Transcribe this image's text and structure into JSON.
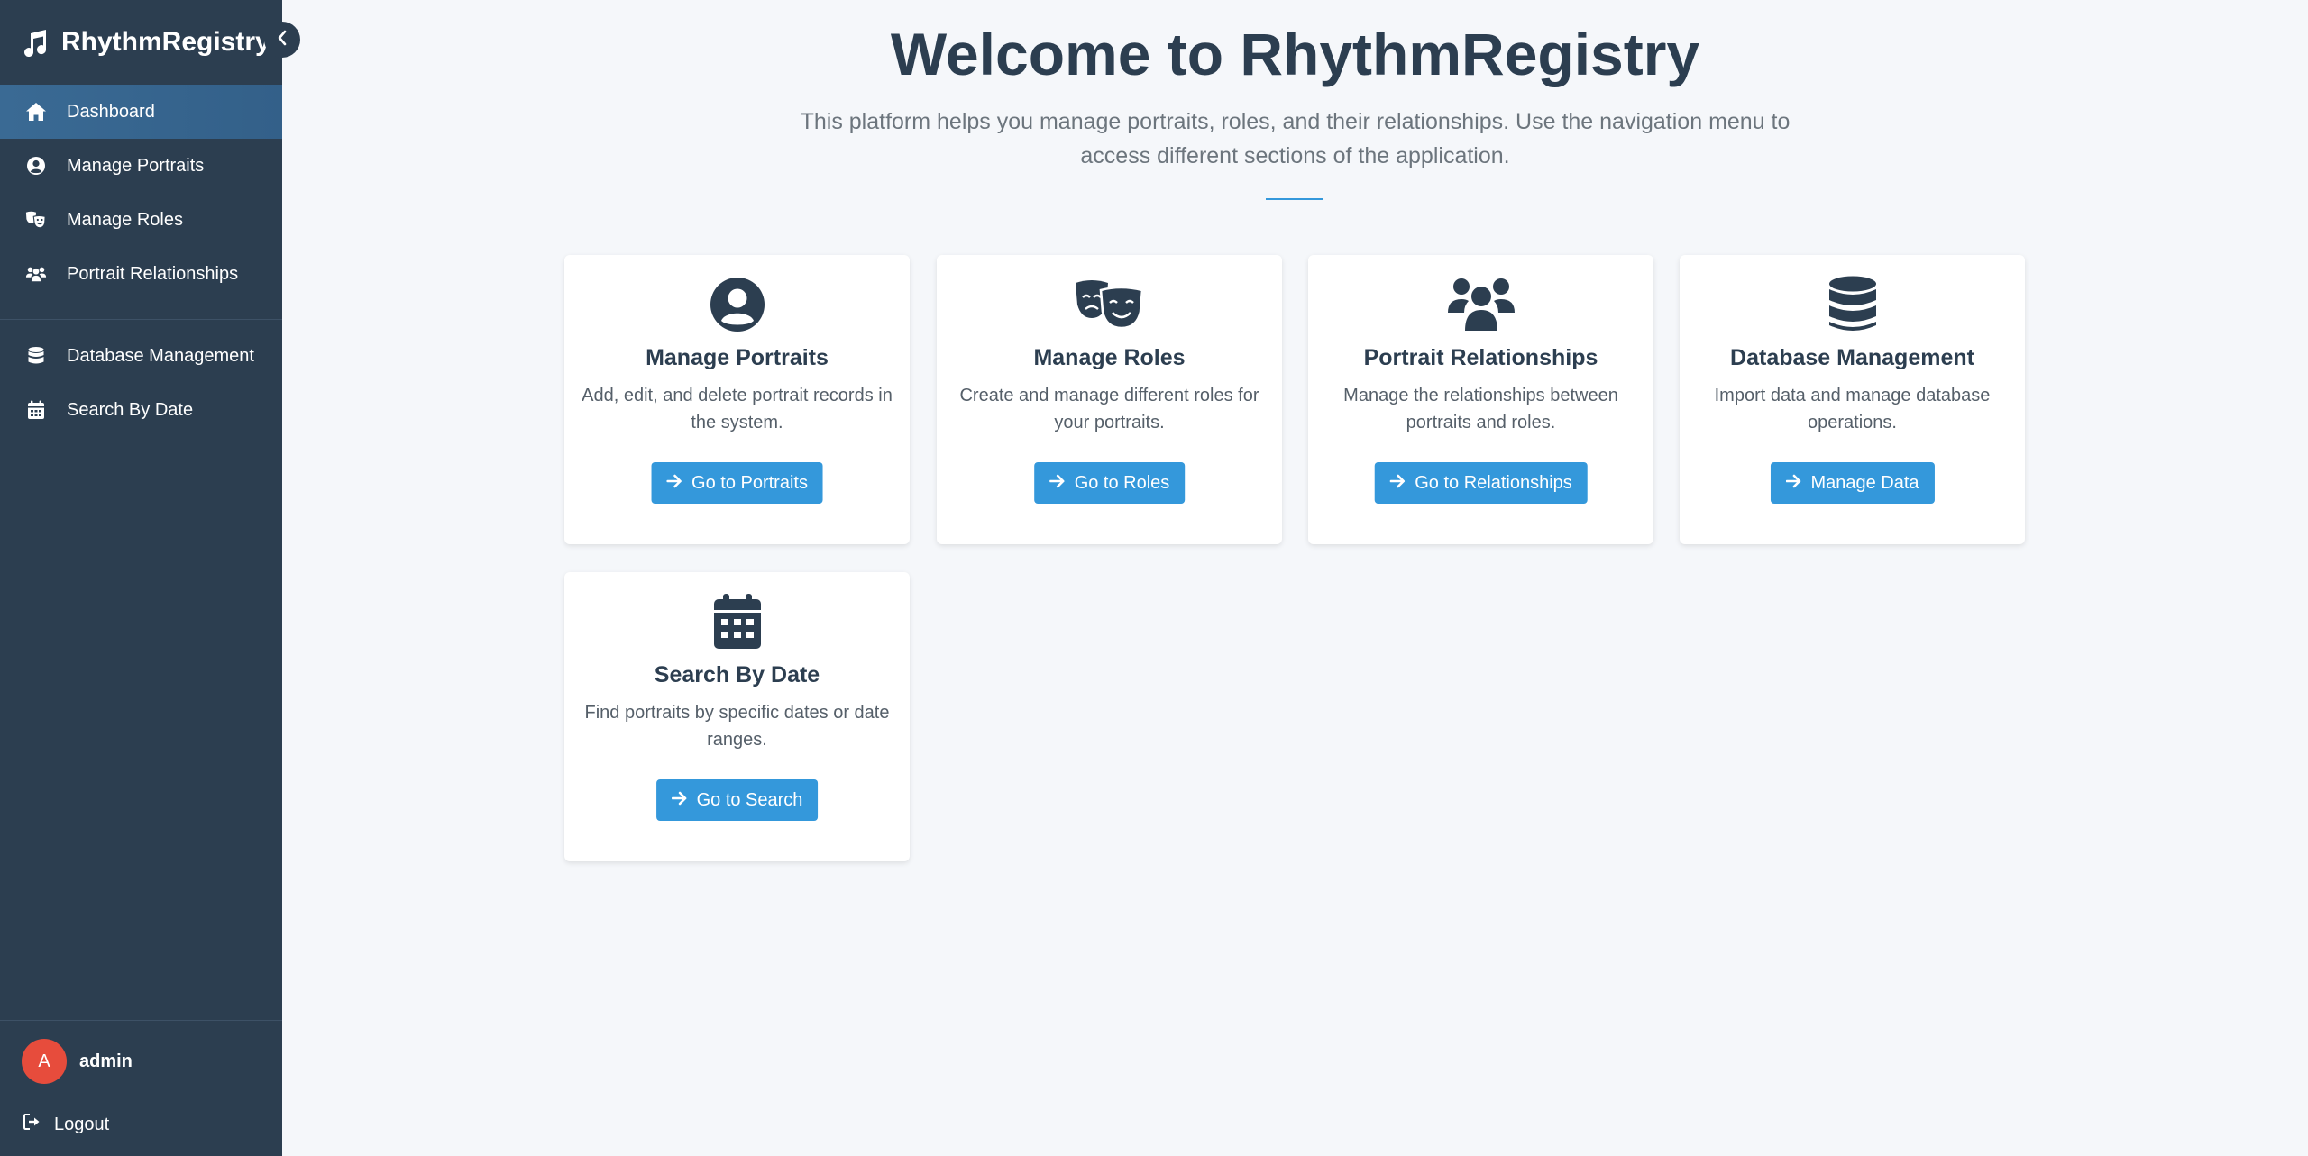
{
  "app": {
    "name": "RhythmRegistry",
    "logo_icon": "music-note-icon"
  },
  "sidebar": {
    "items": [
      {
        "label": "Dashboard",
        "icon": "home-icon",
        "active": true
      },
      {
        "label": "Manage Portraits",
        "icon": "user-circle-icon"
      },
      {
        "label": "Manage Roles",
        "icon": "theater-masks-icon"
      },
      {
        "label": "Portrait Relationships",
        "icon": "users-icon"
      }
    ],
    "items2": [
      {
        "label": "Database Management",
        "icon": "database-icon"
      },
      {
        "label": "Search By Date",
        "icon": "calendar-icon"
      }
    ],
    "user": {
      "initial": "A",
      "name": "admin",
      "avatar_color": "#e74c3c"
    },
    "logout_label": "Logout"
  },
  "main": {
    "title": "Welcome to RhythmRegistry",
    "subtitle": "This platform helps you manage portraits, roles, and their relationships. Use the navigation menu to access different sections of the application.",
    "cards": [
      {
        "title": "Manage Portraits",
        "description": "Add, edit, and delete portrait records in the system.",
        "button": "Go to Portraits",
        "icon": "user-circle-icon"
      },
      {
        "title": "Manage Roles",
        "description": "Create and manage different roles for your portraits.",
        "button": "Go to Roles",
        "icon": "theater-masks-icon"
      },
      {
        "title": "Portrait Relationships",
        "description": "Manage the relationships between portraits and roles.",
        "button": "Go to Relationships",
        "icon": "users-icon"
      },
      {
        "title": "Database Management",
        "description": "Import data and manage database operations.",
        "button": "Manage Data",
        "icon": "database-icon"
      },
      {
        "title": "Search By Date",
        "description": "Find portraits by specific dates or date ranges.",
        "button": "Go to Search",
        "icon": "calendar-icon"
      }
    ]
  },
  "colors": {
    "sidebar_bg": "#2c3e50",
    "active_item_bg": "#34618a",
    "accent": "#3498db",
    "page_bg": "#f5f7fa",
    "text_dark": "#2c3e50"
  }
}
